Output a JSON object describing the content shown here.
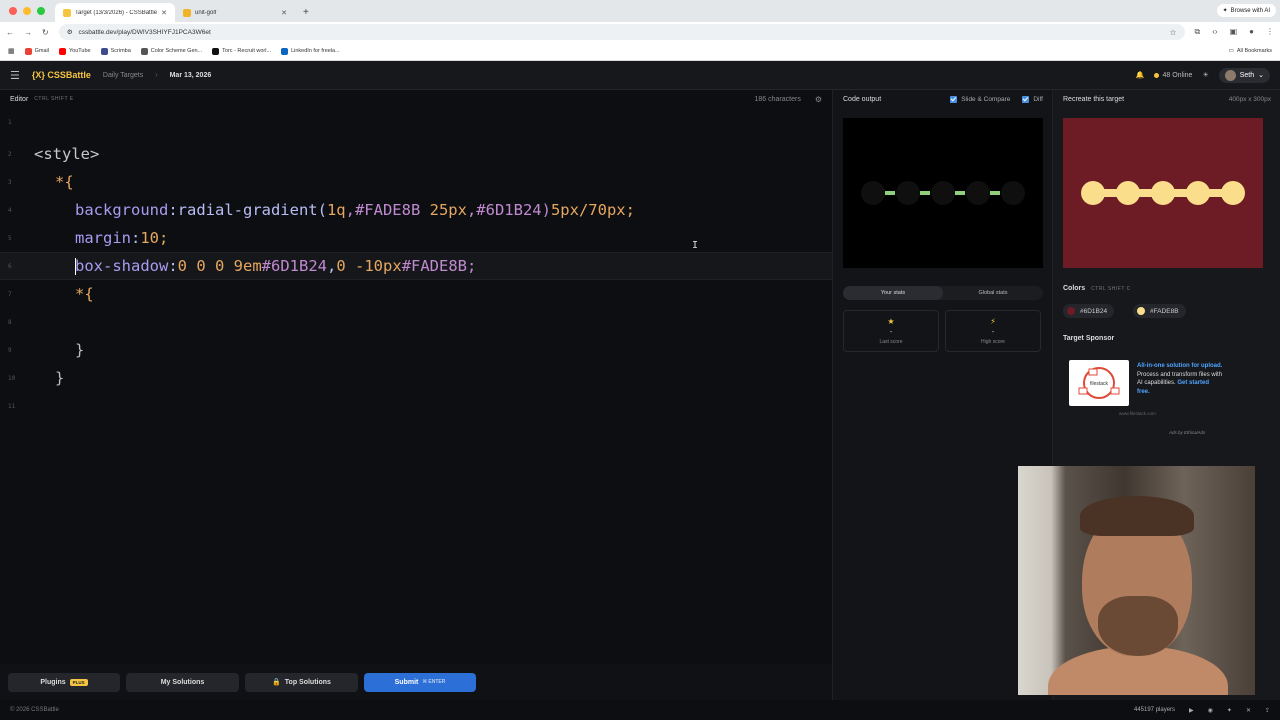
{
  "browser": {
    "tabs": [
      {
        "title": "Target (13/3/2026) - CSSBattle",
        "active": true,
        "fav": "#f5c542"
      },
      {
        "title": "unit-golf",
        "active": false,
        "fav": "#f0b429"
      }
    ],
    "new_tab": "+",
    "browse_ai": "Browse with AI",
    "url": "cssbattle.dev/play/DWIV3SHIYFJ1PCA3W6et",
    "bookmarks": [
      "Gmail",
      "YouTube",
      "Scrimba",
      "Color Scheme Gen...",
      "Torc - Recruit worl...",
      "LinkedIn for freela..."
    ],
    "all_bookmarks": "All Bookmarks"
  },
  "header": {
    "logo": "{X} CSSBattle",
    "crumb": "Daily Targets",
    "date": "Mar 13, 2026",
    "online": "48 Online",
    "user": "Seth"
  },
  "editor": {
    "label": "Editor",
    "shortcut": "CTRL SHIFT E",
    "char_count": "186 characters"
  },
  "code_lines": [
    {
      "n": "1",
      "text": ""
    },
    {
      "n": "2",
      "text": "<style>"
    },
    {
      "n": "3",
      "text": "*{"
    },
    {
      "n": "4",
      "p1": "background",
      "p2": ":radial-gradient(",
      "p3": "1q",
      "p4": ",#FADE8B ",
      "p5": "25px",
      "p6": ",#6D1B24)",
      "p7": "5px/70px",
      "p8": ";"
    },
    {
      "n": "5",
      "p1": "margin",
      "p2": ":",
      "p3": "10",
      "p4": ";"
    },
    {
      "n": "6",
      "p1": "box-shadow",
      "p2": ":",
      "p3": "0 0 0 9",
      "p4": "em",
      "p5": "#6D1B24",
      "p6": ",",
      "p7": "0 -10",
      "p8": "px",
      "p9": "#FADE8B;"
    },
    {
      "n": "7",
      "text": "*{"
    },
    {
      "n": "8",
      "text": ""
    },
    {
      "n": "9",
      "text": "}"
    },
    {
      "n": "10",
      "text": "}"
    },
    {
      "n": "11",
      "text": ""
    }
  ],
  "buttons": {
    "plugins": "Plugins",
    "plus": "PLUS",
    "my_solutions": "My Solutions",
    "top_solutions": "Top Solutions",
    "submit": "Submit",
    "enter": "ENTER"
  },
  "output": {
    "title": "Code output",
    "slide_compare": "Slide & Compare",
    "diff": "Diff",
    "tabs": [
      "Your stats",
      "Global stats"
    ],
    "last_score_label": "Last score",
    "high_score_label": "High score",
    "last_score": "-",
    "high_score": "-"
  },
  "target": {
    "title": "Recreate this target",
    "size": "400px x 300px",
    "colors_label": "Colors",
    "colors_shortcut": "CTRL SHIFT C",
    "colors": [
      "#6D1B24",
      "#FADE8B"
    ],
    "sponsor_title": "Target Sponsor",
    "sponsor_text_1": "All-in-one solution for upload.",
    "sponsor_text_2": " Process and transform files with AI capabilities. ",
    "sponsor_text_3": "Get started free.",
    "sponsor_img_text": "filestack",
    "sponsor_url": "www.filestack.com",
    "ads_by": "Ads by EthicalAds"
  },
  "footer": {
    "copyright": "© 2026 CSSBattle",
    "players": "445197 players"
  }
}
